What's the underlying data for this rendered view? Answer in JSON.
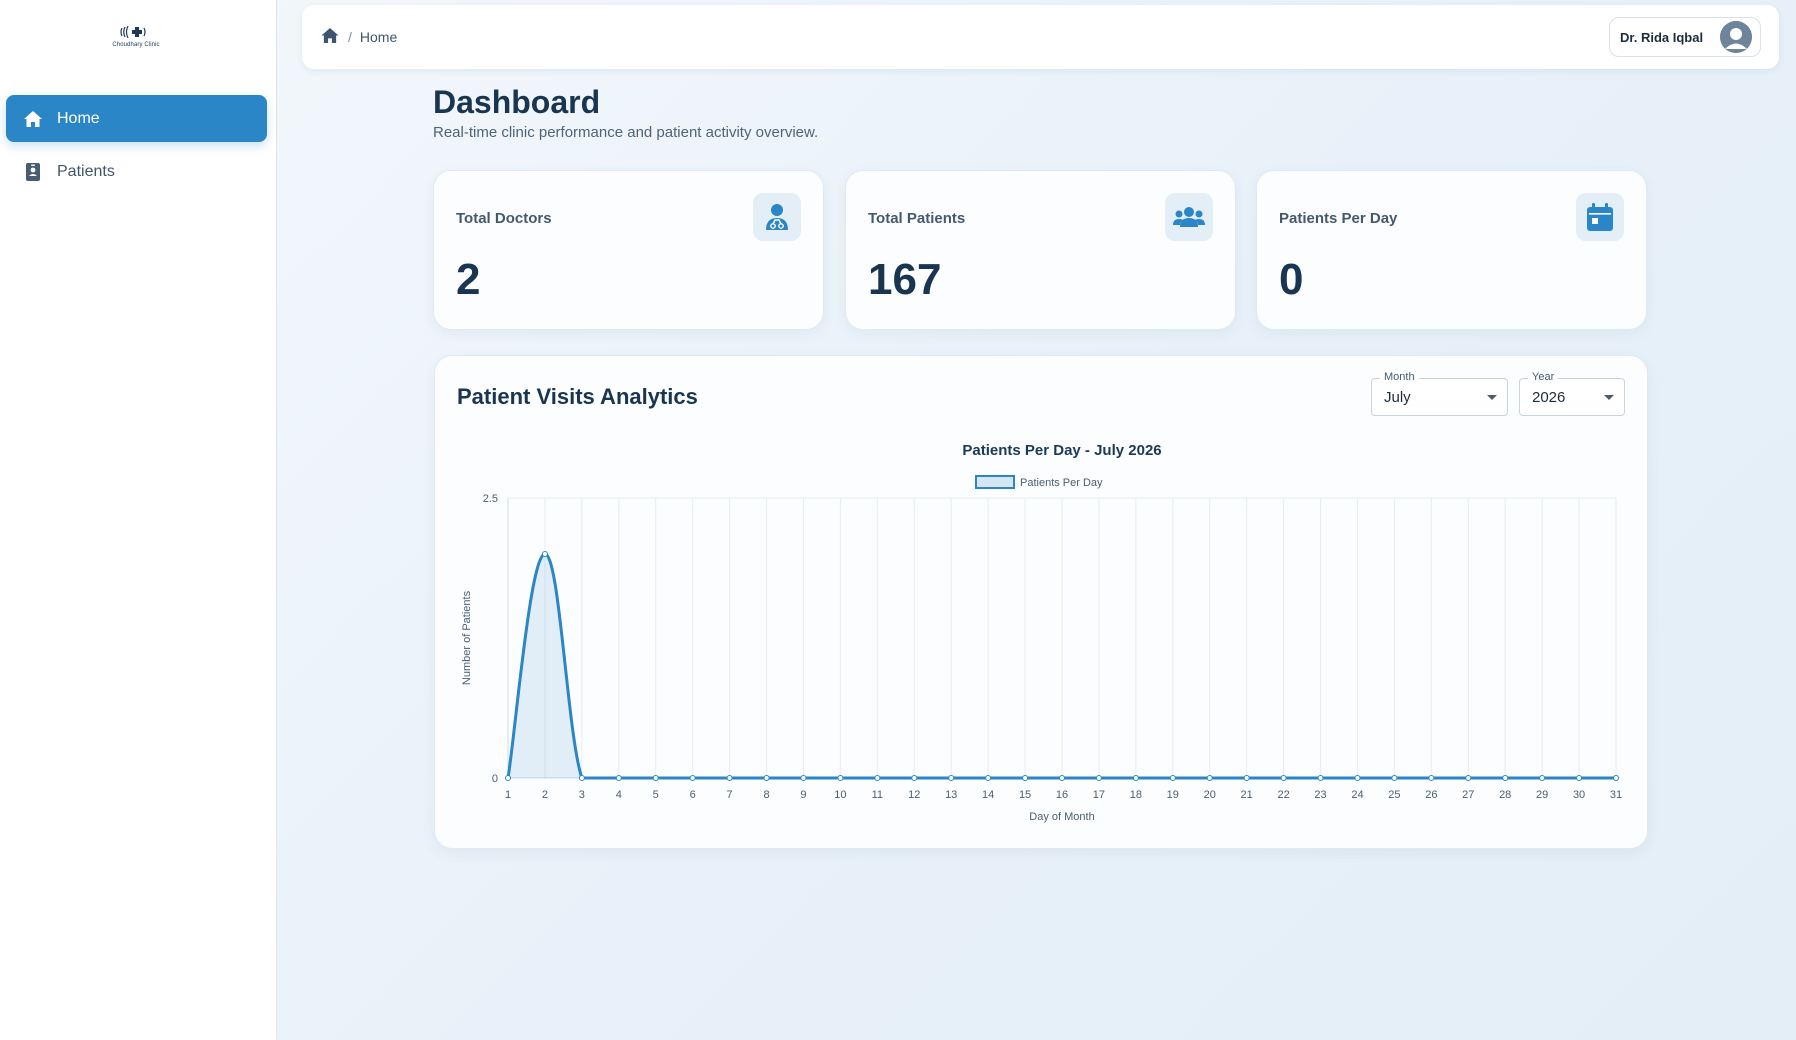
{
  "sidebar": {
    "logo_text": "Choudhary Clinic",
    "items": [
      {
        "label": "Home",
        "icon": "home-icon",
        "active": true
      },
      {
        "label": "Patients",
        "icon": "id-badge-icon",
        "active": false
      }
    ]
  },
  "topbar": {
    "breadcrumb": "Home",
    "breadcrumb_sep": "/",
    "user_name": "Dr. Rida Iqbal"
  },
  "header": {
    "title": "Dashboard",
    "subtitle": "Real-time clinic performance and patient activity overview."
  },
  "stats": [
    {
      "label": "Total Doctors",
      "value": "2",
      "icon": "user-doctor-icon"
    },
    {
      "label": "Total Patients",
      "value": "167",
      "icon": "users-icon"
    },
    {
      "label": "Patients Per Day",
      "value": "0",
      "icon": "calendar-icon"
    }
  ],
  "analytics": {
    "title": "Patient Visits Analytics",
    "month_label": "Month",
    "month_value": "July",
    "year_label": "Year",
    "year_value": "2026"
  },
  "colors": {
    "accent": "#2a86c6",
    "text_dark": "#1a3550",
    "icon_bg": "#e4eef6"
  },
  "chart_data": {
    "type": "line",
    "title": "Patients Per Day - July 2026",
    "xlabel": "Day of Month",
    "ylabel": "Number of Patients",
    "x": [
      1,
      2,
      3,
      4,
      5,
      6,
      7,
      8,
      9,
      10,
      11,
      12,
      13,
      14,
      15,
      16,
      17,
      18,
      19,
      20,
      21,
      22,
      23,
      24,
      25,
      26,
      27,
      28,
      29,
      30,
      31
    ],
    "series": [
      {
        "name": "Patients Per Day",
        "values": [
          0,
          2,
          0,
          0,
          0,
          0,
          0,
          0,
          0,
          0,
          0,
          0,
          0,
          0,
          0,
          0,
          0,
          0,
          0,
          0,
          0,
          0,
          0,
          0,
          0,
          0,
          0,
          0,
          0,
          0,
          0
        ]
      }
    ],
    "ylim": [
      0,
      2.5
    ],
    "yticks": [
      "0",
      "2.5"
    ],
    "grid": true,
    "legend": "top",
    "filled": true
  }
}
